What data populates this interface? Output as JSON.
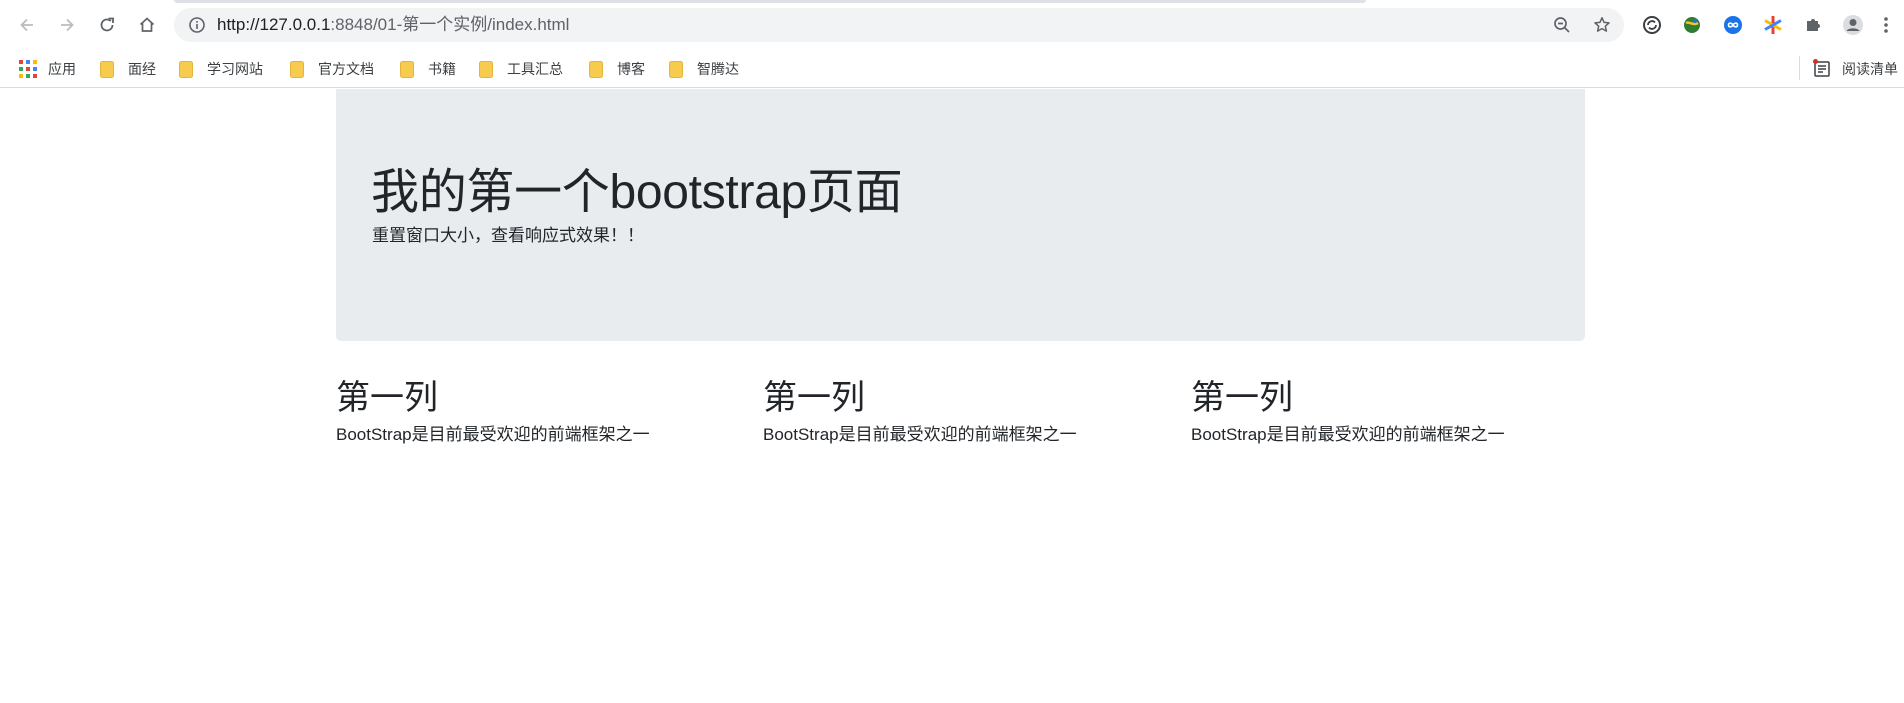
{
  "browser": {
    "url_host": "http://127.0.0.1",
    "url_rest": ":8848/01-第一个实例/index.html"
  },
  "bookmarks": {
    "apps_label": "应用",
    "items": [
      {
        "label": "面经"
      },
      {
        "label": "学习网站"
      },
      {
        "label": "官方文档"
      },
      {
        "label": "书籍"
      },
      {
        "label": "工具汇总"
      },
      {
        "label": "博客"
      },
      {
        "label": "智腾达"
      }
    ],
    "reading_list_label": "阅读清单"
  },
  "colors": {
    "folder": "#f7cb4d",
    "jumbotron_bg": "#e9ecef",
    "text": "#212529"
  },
  "jumbotron": {
    "title": "我的第一个bootstrap页面",
    "subtitle": "重置窗口大小，查看响应式效果！！"
  },
  "columns": [
    {
      "heading": "第一列",
      "text": "BootStrap是目前最受欢迎的前端框架之一"
    },
    {
      "heading": "第一列",
      "text": "BootStrap是目前最受欢迎的前端框架之一"
    },
    {
      "heading": "第一列",
      "text": "BootStrap是目前最受欢迎的前端框架之一"
    }
  ]
}
